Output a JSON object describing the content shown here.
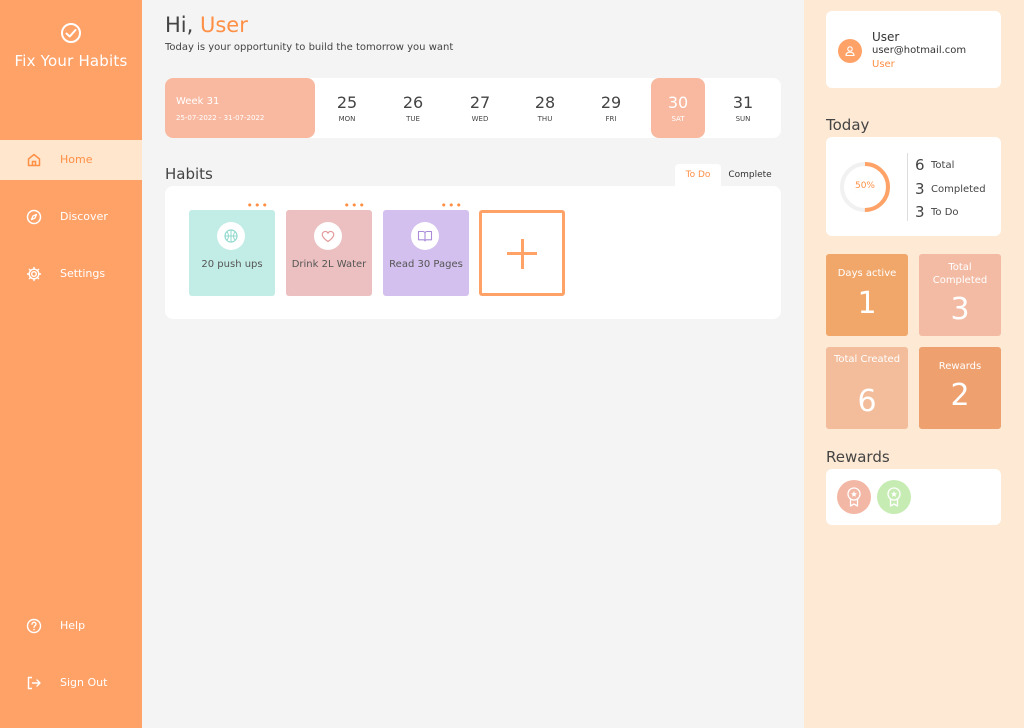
{
  "brand": {
    "title": "Fix Your Habits",
    "icon": "check-circle-icon"
  },
  "nav": {
    "items": [
      {
        "label": "Home",
        "icon": "home-icon",
        "active": true
      },
      {
        "label": "Discover",
        "icon": "compass-icon",
        "active": false
      },
      {
        "label": "Settings",
        "icon": "gear-icon",
        "active": false
      }
    ],
    "bottom": [
      {
        "label": "Help",
        "icon": "help-icon"
      },
      {
        "label": "Sign Out",
        "icon": "sign-out-icon"
      }
    ]
  },
  "header": {
    "greeting": "Hi,",
    "user_name": "User",
    "subtitle": "Today is your opportunity to build the tomorrow you want"
  },
  "week": {
    "label": "Week 31",
    "range": "25-07-2022 - 31-07-2022",
    "days": [
      {
        "num": "25",
        "name": "MON",
        "selected": false
      },
      {
        "num": "26",
        "name": "TUE",
        "selected": false
      },
      {
        "num": "27",
        "name": "WED",
        "selected": false
      },
      {
        "num": "28",
        "name": "THU",
        "selected": false
      },
      {
        "num": "29",
        "name": "FRI",
        "selected": false
      },
      {
        "num": "30",
        "name": "SAT",
        "selected": true
      },
      {
        "num": "31",
        "name": "SUN",
        "selected": false
      }
    ]
  },
  "habits": {
    "title": "Habits",
    "tabs": [
      {
        "label": "To Do",
        "active": true
      },
      {
        "label": "Complete",
        "active": false
      }
    ],
    "more_label": "•••",
    "items": [
      {
        "label": "20 push ups",
        "icon": "basketball-icon",
        "color": "#c2ece6"
      },
      {
        "label": "Drink 2L Water",
        "icon": "heart-icon",
        "color": "#ecc0c0"
      },
      {
        "label": "Read 30 Pages",
        "icon": "book-icon",
        "color": "#d3c0ee"
      }
    ]
  },
  "user": {
    "name": "User",
    "email": "user@hotmail.com",
    "role": "User"
  },
  "today": {
    "title": "Today",
    "progress_label": "50%",
    "progress": 0.5,
    "stats": [
      {
        "value": "6",
        "label": "Total"
      },
      {
        "value": "3",
        "label": "Completed"
      },
      {
        "value": "3",
        "label": "To Do"
      }
    ]
  },
  "tiles": [
    {
      "label": "Days active",
      "value": "1",
      "color": "#f1a76a"
    },
    {
      "label": "Total Completed",
      "value": "3",
      "color": "#f3bba4"
    },
    {
      "label": "Total Created",
      "value": "6",
      "color": "#f3bc9a"
    },
    {
      "label": "Rewards",
      "value": "2",
      "color": "#eea06e"
    }
  ],
  "rewards": {
    "title": "Rewards",
    "badges": [
      {
        "icon": "award-badge-icon",
        "color": "#f3b7a5"
      },
      {
        "icon": "award-badge-icon",
        "color": "#c6ecb4"
      }
    ]
  },
  "colors": {
    "accent": "#ff8f45",
    "sidebar": "#ffa268",
    "right_panel": "#fde9d4"
  }
}
